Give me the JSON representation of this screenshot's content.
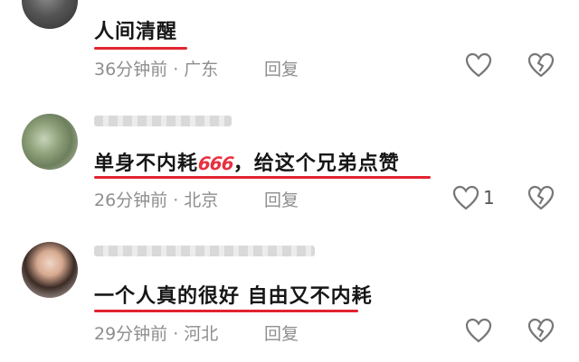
{
  "comments": [
    {
      "text": "人间清醒",
      "meta": "36分钟前 · 广东",
      "reply": "回复",
      "like_count": ""
    },
    {
      "text_before": "单身不内耗",
      "emoji": "666",
      "text_after": "，给这个兄弟点赞",
      "meta": "26分钟前 · 北京",
      "reply": "回复",
      "like_count": "1"
    },
    {
      "text": "一个人真的很好 自由又不内耗",
      "meta": "29分钟前 · 河北",
      "reply": "回复",
      "like_count": ""
    }
  ],
  "colors": {
    "underline": "#e2242f",
    "meta": "#8e8e8e",
    "icon": "#777777"
  },
  "icons": [
    "heart-outline-icon",
    "broken-heart-icon"
  ]
}
